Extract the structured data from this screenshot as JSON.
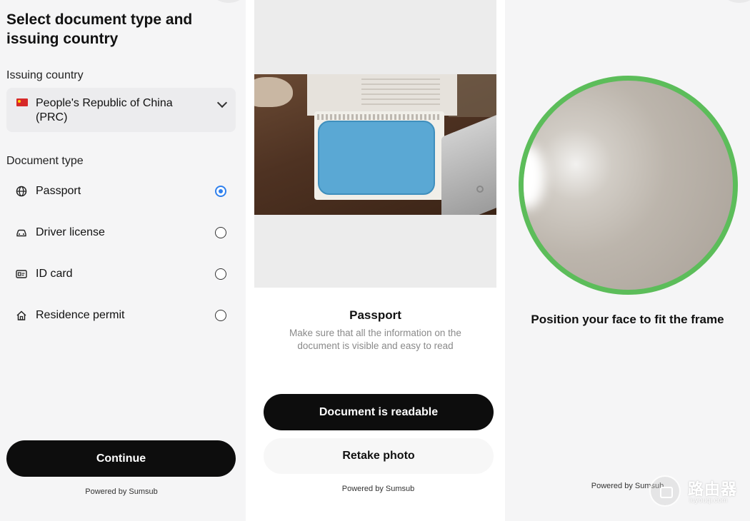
{
  "screen1": {
    "title": "Select document type and issuing country",
    "issuing_country_label": "Issuing country",
    "country": {
      "flag_icon": "china-flag-icon",
      "value": "People's Republic of China (PRC)"
    },
    "document_type_label": "Document type",
    "document_types": [
      {
        "label": "Passport",
        "icon": "globe-icon",
        "selected": true
      },
      {
        "label": "Driver license",
        "icon": "car-icon",
        "selected": false
      },
      {
        "label": "ID card",
        "icon": "id-card-icon",
        "selected": false
      },
      {
        "label": "Residence permit",
        "icon": "home-icon",
        "selected": false
      }
    ],
    "continue_button": "Continue",
    "powered_by": "Powered by Sumsub"
  },
  "screen2": {
    "title": "Passport",
    "description": "Make sure that all the information on the document is visible and easy to read",
    "primary_button": "Document is readable",
    "secondary_button": "Retake photo",
    "powered_by": "Powered by Sumsub"
  },
  "screen3": {
    "caption": "Position your face to fit the frame",
    "powered_by": "Powered by Sumsub",
    "frame_color": "#5cbd5a"
  },
  "watermark": {
    "text": "路由器",
    "subtext": "luyouqi.com"
  },
  "colors": {
    "accent": "#2f80ed",
    "button_dark": "#0d0d0d",
    "face_frame": "#5cbd5a"
  }
}
